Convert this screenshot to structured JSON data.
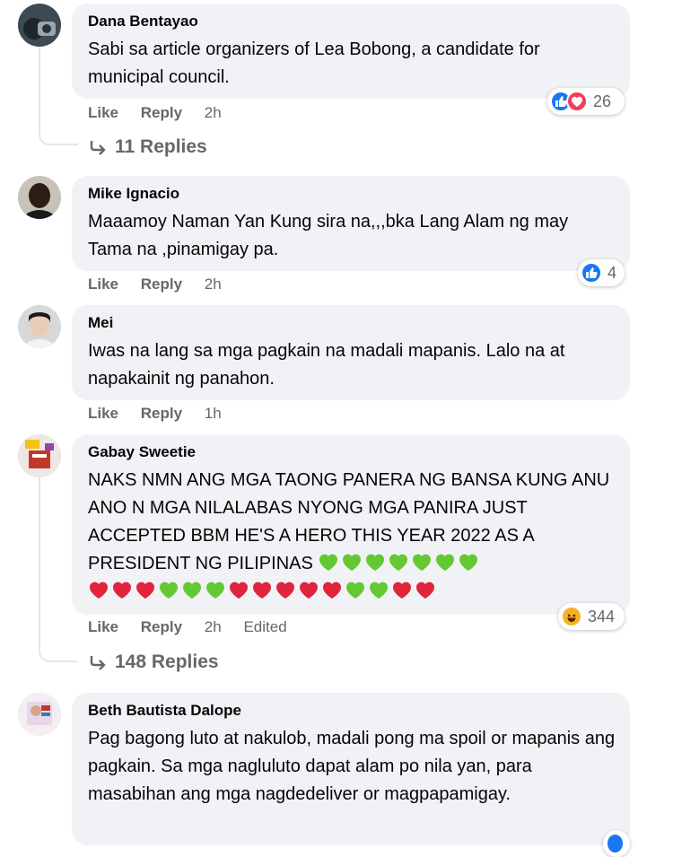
{
  "comments": [
    {
      "author": "Dana Bentayao",
      "text": "Sabi sa article organizers of Lea Bobong, a candidate for municipal council.",
      "like": "Like",
      "reply": "Reply",
      "time": "2h",
      "reactions": "26",
      "reaction_icons": [
        "like-icon",
        "love-icon"
      ],
      "replies": "11 Replies"
    },
    {
      "author": "Mike Ignacio",
      "text": "Maaamoy Naman Yan Kung sira na,,,bka Lang Alam ng may Tama na ,pinamigay pa.",
      "like": "Like",
      "reply": "Reply",
      "time": "2h",
      "reactions": "4",
      "reaction_icons": [
        "like-icon"
      ]
    },
    {
      "author": "Mei",
      "text": "Iwas na lang sa mga pagkain na madali mapanis. Lalo na at napakainit ng panahon.",
      "like": "Like",
      "reply": "Reply",
      "time": "1h"
    },
    {
      "author": "Gabay Sweetie",
      "text": "NAKS NMN ANG MGA TAONG PANERA NG BANSA KUNG ANU ANO N MGA NILALABAS NYONG MGA PANIRA JUST ACCEPTED BBM HE'S A HERO THIS YEAR 2022 AS A PRESIDENT NG PILIPINAS",
      "hearts_line1": [
        "green",
        "green",
        "green",
        "green",
        "green",
        "green",
        "green"
      ],
      "hearts_line2": [
        "red",
        "red",
        "red",
        "green",
        "green",
        "green",
        "red",
        "red",
        "red",
        "red",
        "red",
        "green",
        "green",
        "red",
        "red"
      ],
      "like": "Like",
      "reply": "Reply",
      "time": "2h",
      "edited": "Edited",
      "reactions": "344",
      "reaction_icons": [
        "haha-icon"
      ],
      "replies": "148 Replies"
    },
    {
      "author": "Beth Bautista Dalope",
      "text": "Pag bagong luto at nakulob, madali pong ma spoil or mapanis ang pagkain. Sa mga nagluluto dapat alam po nila yan, para masabihan ang mga nagdedeliver or magpapamigay."
    }
  ],
  "colors": {
    "like_blue": "#1877f2",
    "love_red": "#f33e58",
    "haha_yellow": "#f7b125",
    "heart_red": "#e0243b",
    "heart_green": "#64c832"
  }
}
